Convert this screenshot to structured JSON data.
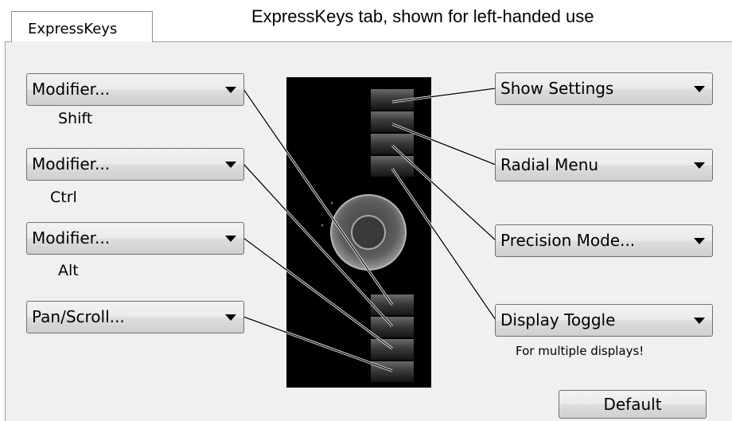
{
  "caption": "ExpressKeys tab, shown for left-handed use",
  "tab": {
    "label": "ExpressKeys"
  },
  "left_keys": [
    {
      "value": "Modifier...",
      "sub": "Shift"
    },
    {
      "value": "Modifier...",
      "sub": "Ctrl"
    },
    {
      "value": "Modifier...",
      "sub": "Alt"
    },
    {
      "value": "Pan/Scroll...",
      "sub": ""
    }
  ],
  "right_keys": [
    {
      "value": "Show Settings"
    },
    {
      "value": "Radial Menu"
    },
    {
      "value": "Precision Mode..."
    },
    {
      "value": "Display Toggle",
      "note": "For multiple displays!"
    }
  ],
  "default_button": "Default",
  "colors": {
    "panel": "#f0f0f0",
    "tablet": "#000000",
    "leader_line": "#000000"
  }
}
